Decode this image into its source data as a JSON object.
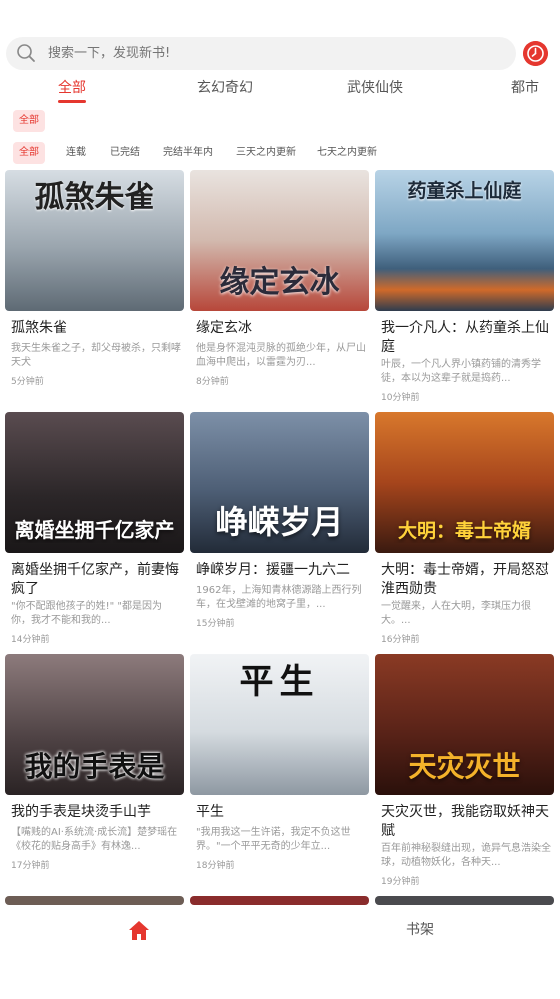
{
  "search": {
    "placeholder": "搜索一下，发现新书!"
  },
  "tabs": [
    {
      "label": "全部",
      "active": true
    },
    {
      "label": "玄幻奇幻"
    },
    {
      "label": "武侠仙侠"
    },
    {
      "label": "都市"
    }
  ],
  "category_chip": "全部",
  "filters": [
    {
      "label": "全部",
      "active": true
    },
    {
      "label": "连载"
    },
    {
      "label": "已完结"
    },
    {
      "label": "完结半年内"
    },
    {
      "label": "三天之内更新"
    },
    {
      "label": "七天之内更新"
    }
  ],
  "books": [
    {
      "title": "孤煞朱雀",
      "desc": "我天生朱雀之子，却父母被杀，只剩哮天犬",
      "time": "5分钟前",
      "cover_text": "孤煞朱雀",
      "cover_color": "#7f8c95"
    },
    {
      "title": "缘定玄冰",
      "desc": "他是身怀混沌灵脉的孤绝少年，从尸山血海中爬出，以雷霆为刃...",
      "time": "8分钟前",
      "cover_text": "缘定玄冰",
      "cover_color": "#c9b5ad"
    },
    {
      "title": "我一介凡人：从药童杀上仙庭",
      "desc": "叶辰，一个凡人界小镇药铺的清秀学徒，本以为这辈子就是捣药...",
      "time": "10分钟前",
      "cover_text": "药童杀上仙庭",
      "cover_color": "#8fb6d1"
    },
    {
      "title": "离婚坐拥千亿家产，前妻悔疯了",
      "desc": "\"你不配跟他孩子的姓!\" \"都是因为你，我才不能和我的...",
      "time": "14分钟前",
      "cover_text": "离婚坐拥千亿家产",
      "cover_color": "#3a3436"
    },
    {
      "title": "峥嵘岁月：援疆一九六二",
      "desc": "1962年，上海知青林德源踏上西行列车，在戈壁滩的地窝子里，...",
      "time": "15分钟前",
      "cover_text": "峥嵘岁月",
      "cover_color": "#5c6f86"
    },
    {
      "title": "大明：毒士帝婿，开局怒怼淮西勋贵",
      "desc": "一觉醒来，人在大明，李琪压力很大。...",
      "time": "16分钟前",
      "cover_text": "大明：毒士帝婿",
      "cover_color": "#a8461f"
    },
    {
      "title": "我的手表是块烫手山芋",
      "desc": "【嘴贱的AI·系统流·成长流】楚梦瑶在《校花的贴身高手》有林逸...",
      "time": "17分钟前",
      "cover_text": "我的手表是",
      "cover_color": "#5d4d4f"
    },
    {
      "title": "平生",
      "desc": "\"我用我这一生许诺，我定不负这世界。\"一个平平无奇的少年立...",
      "time": "18分钟前",
      "cover_text": "平生",
      "cover_color": "#c5ccd2"
    },
    {
      "title": "天灾灭世，我能窃取妖神天赋",
      "desc": "百年前神秘裂缝出现，诡异气息浩染全球，动植物妖化，各种天...",
      "time": "19分钟前",
      "cover_text": "天灾灭世",
      "cover_color": "#5a2318"
    }
  ],
  "bottom_nav": {
    "home_icon": "home-icon",
    "shelf_label": "书架"
  },
  "colors": {
    "accent": "#e5372f"
  }
}
